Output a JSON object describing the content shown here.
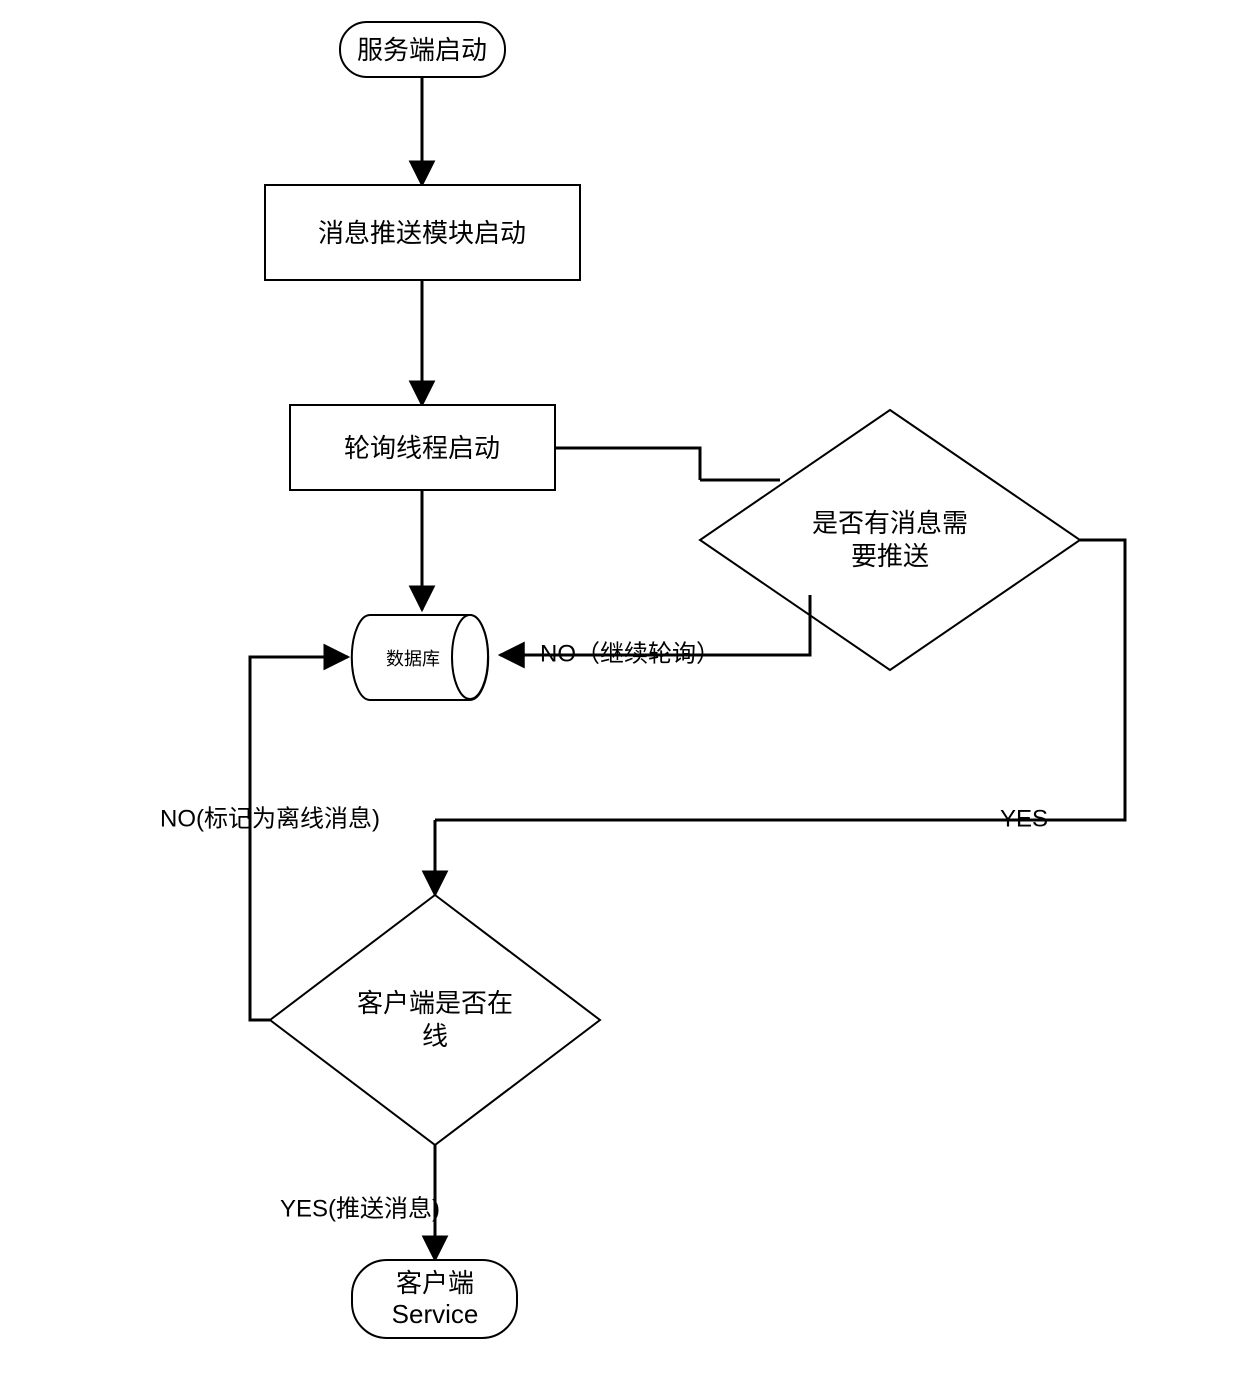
{
  "nodes": {
    "start": "服务端启动",
    "push_module": "消息推送模块启动",
    "poll_thread": "轮询线程启动",
    "db": "数据库",
    "has_msg_1": "是否有消息需",
    "has_msg_2": "要推送",
    "client_online_1": "客户端是否在",
    "client_online_2": "线",
    "end_1": "客户端",
    "end_2": "Service"
  },
  "edges": {
    "no_continue": "NO（继续轮询）",
    "yes_has": "YES",
    "no_offline": "NO(标记为离线消息)",
    "yes_push": "YES(推送消息)"
  }
}
